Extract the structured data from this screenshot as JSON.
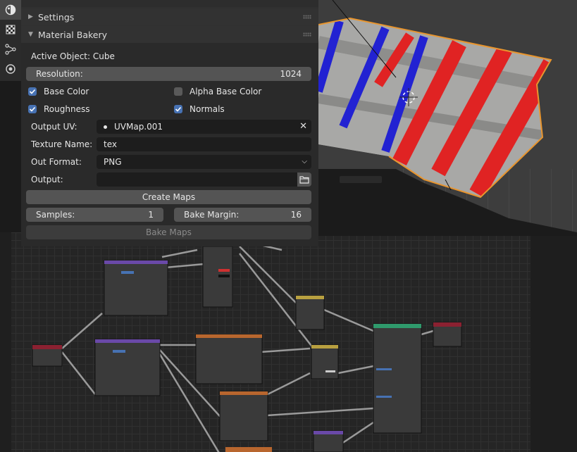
{
  "panel": {
    "settings_header": "Settings",
    "bakery_header": "Material Bakery",
    "active_object": "Active Object: Cube",
    "resolution_label": "Resolution:",
    "resolution_value": "1024",
    "checkboxes": {
      "base_color": {
        "label": "Base Color",
        "checked": true
      },
      "alpha_base_color": {
        "label": "Alpha Base Color",
        "checked": false
      },
      "roughness": {
        "label": "Roughness",
        "checked": true
      },
      "normals": {
        "label": "Normals",
        "checked": true
      }
    },
    "output_uv_label": "Output UV:",
    "output_uv_value": "UVMap.001",
    "texture_name_label": "Texture Name:",
    "texture_name_value": "tex",
    "out_format_label": "Out Format:",
    "out_format_value": "PNG",
    "output_label": "Output:",
    "output_value": "",
    "create_maps_label": "Create Maps",
    "samples_label": "Samples:",
    "samples_value": "1",
    "bake_margin_label": "Bake Margin:",
    "bake_margin_value": "16",
    "bake_maps_label": "Bake Maps"
  },
  "toolstrip": {
    "icons": [
      "material-icon",
      "texture-icon",
      "node-tree-icon",
      "world-icon"
    ]
  },
  "colors": {
    "accent": "#4772b3",
    "panel_bg": "#303030",
    "field_bg": "#1d1d1d",
    "button_bg": "#545454",
    "selection_outline": "#e8952e",
    "stripe_red": "#e02020",
    "stripe_blue": "#2020d0"
  }
}
